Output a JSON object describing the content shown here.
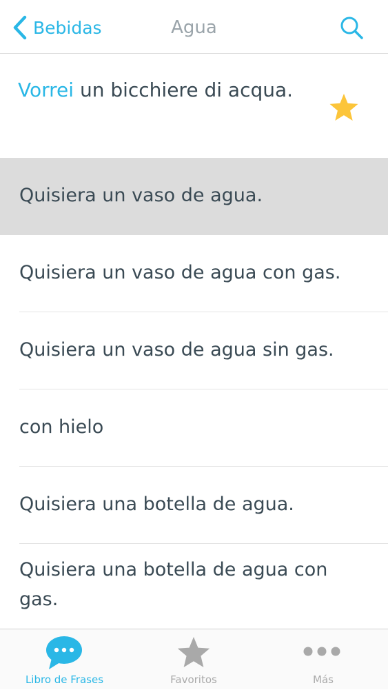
{
  "navbar": {
    "back_label": "Bebidas",
    "title": "Agua"
  },
  "featured": {
    "highlight": "Vorrei",
    "rest": " un bicchiere di acqua."
  },
  "rows": [
    {
      "text": "Quisiera un vaso de agua.",
      "selected": true
    },
    {
      "text": "Quisiera un vaso de agua con gas."
    },
    {
      "text": "Quisiera un vaso de agua sin gas."
    },
    {
      "text": "con hielo"
    },
    {
      "text": "Quisiera una botella de agua."
    },
    {
      "text": "Quisiera una botella de agua con gas."
    }
  ],
  "tabbar": {
    "tabs": [
      {
        "label": "Libro de Frases",
        "icon": "chat-bubble-icon",
        "active": true
      },
      {
        "label": "Favoritos",
        "icon": "star-icon"
      },
      {
        "label": "Más",
        "icon": "more-dots-icon"
      }
    ]
  },
  "colors": {
    "accent": "#2ab7e6",
    "star": "#fcc53a",
    "selected_row": "#dcdcdc",
    "inactive_tab": "#a9a9a9"
  }
}
